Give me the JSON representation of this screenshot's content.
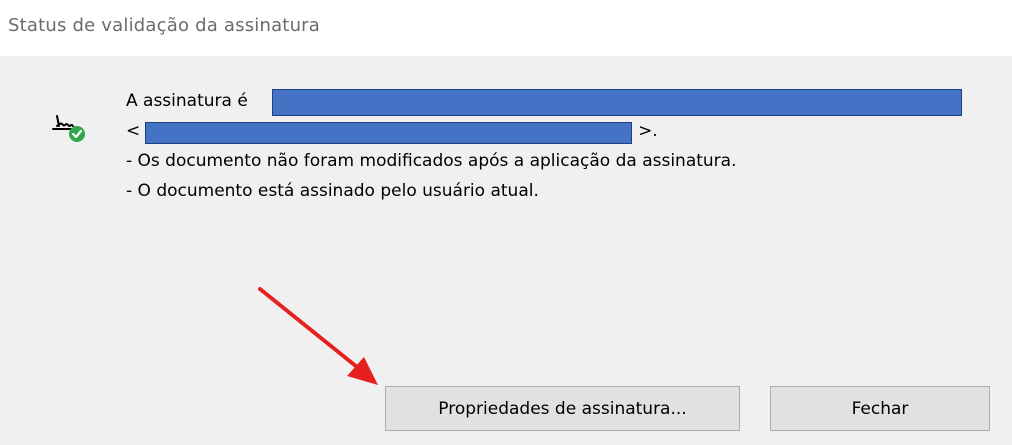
{
  "window": {
    "title": "Status de validação da assinatura"
  },
  "message": {
    "line1_prefix": "A assinatura é",
    "line2_prefix": "<",
    "line2_suffix": ">.",
    "line3": "- Os documento não foram modificados após a aplicação da assinatura.",
    "line4": "- O documento está assinado pelo usuário atual."
  },
  "icon": {
    "name": "signature-valid-icon",
    "check_color": "#2ea84a"
  },
  "buttons": {
    "properties_label": "Propriedades de assinatura...",
    "close_label": "Fechar"
  },
  "annotation": {
    "arrow_color": "#e81f1f",
    "redaction_color": "#4472c4"
  }
}
